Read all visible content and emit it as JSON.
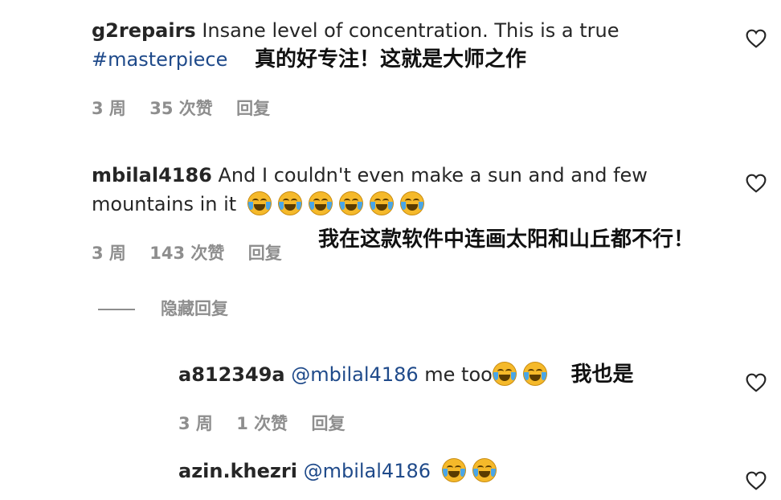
{
  "comments": [
    {
      "username": "g2repairs",
      "text1": " Insane level of concentration. This is a true",
      "hashtag": "#masterpiece",
      "translation": "真的好专注！这就是大师之作",
      "time": "3 周",
      "likes": "35 次赞",
      "reply": "回复"
    },
    {
      "username": "mbilal4186",
      "text1": " And I couldn't even make a sun and and few",
      "text2": "mountains in it",
      "translation": "我在这款软件中连画太阳和山丘都不行！",
      "time": "3 周",
      "likes": "143 次赞",
      "reply": "回复",
      "hide_replies": "隐藏回复",
      "emoji_count": 6
    },
    {
      "username": "a812349a",
      "mention": "@mbilal4186",
      "text": " me too",
      "translation": "我也是",
      "time": "3 周",
      "likes": "1 次赞",
      "reply": "回复",
      "emoji_count": 2
    },
    {
      "username": "azin.khezri",
      "mention": "@mbilal4186",
      "emoji_count": 2
    }
  ],
  "icons": {
    "like": "heart-outline-icon",
    "emoji": "tears-of-joy-emoji"
  }
}
